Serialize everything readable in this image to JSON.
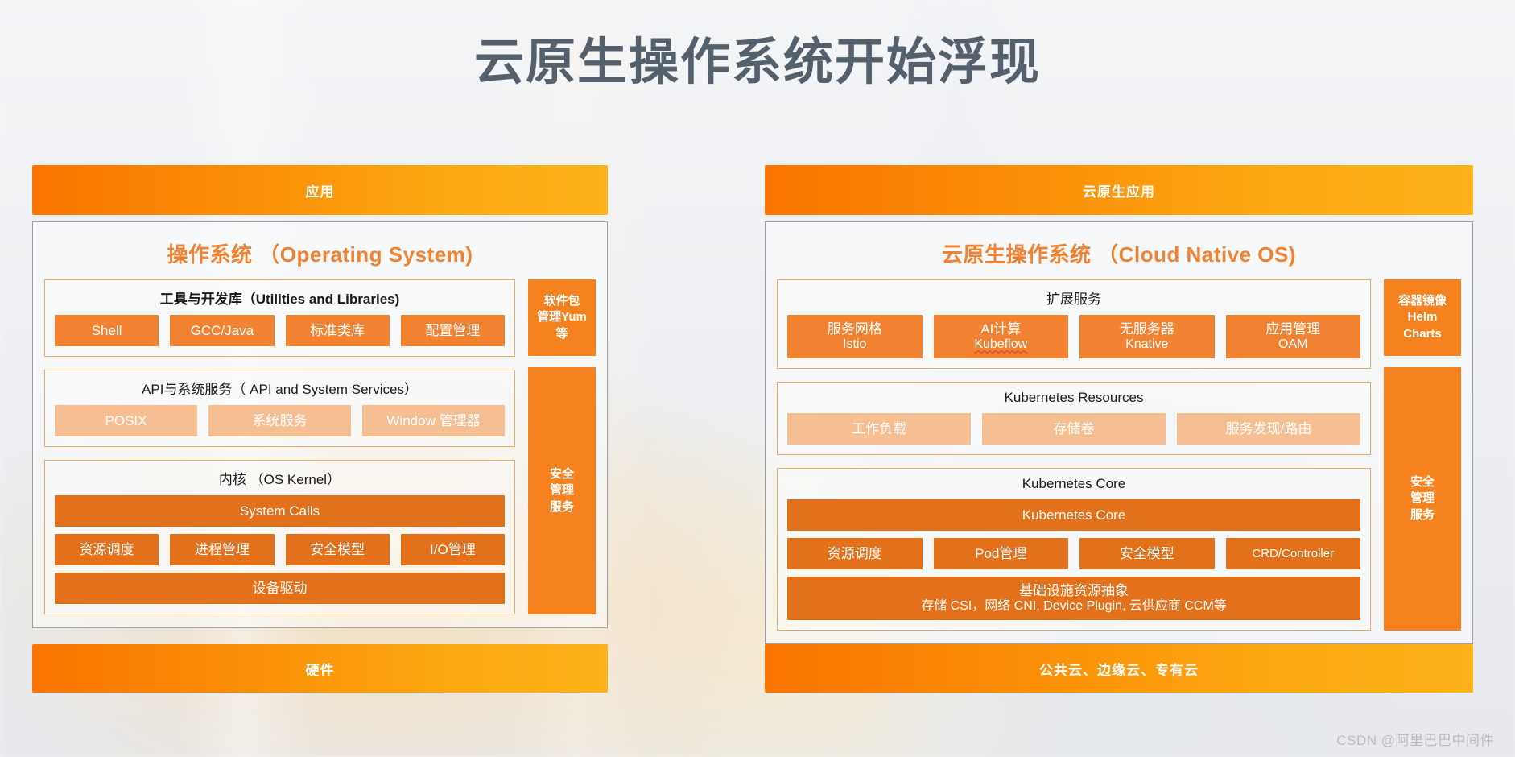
{
  "slide": {
    "title": "云原生操作系统开始浮现",
    "watermark": "CSDN @阿里巴巴中间件"
  },
  "colors": {
    "accent_orange": "#f5811f",
    "chip_orange": "#f08232",
    "chip_dark_orange": "#e3701b",
    "chip_light_orange": "#f6bf93",
    "title_gray": "#54616c",
    "panel_border": "#9aa0a6",
    "group_border": "#e8a86a"
  },
  "left_panel": {
    "top_bar": "应用",
    "os_title": "操作系统 （Operating System)",
    "groups": [
      {
        "title": "工具与开发库（Utilities and Libraries)",
        "title_bold": true,
        "rows": [
          {
            "style": "solid",
            "items": [
              "Shell",
              "GCC/Java",
              "标准类库",
              "配置管理"
            ]
          }
        ]
      },
      {
        "title": "API与系统服务（ API and  System Services）",
        "title_bold": false,
        "rows": [
          {
            "style": "light",
            "items": [
              "POSIX",
              "系统服务",
              "Window 管理器"
            ]
          }
        ]
      },
      {
        "title": "内核 （OS Kernel）",
        "title_bold": false,
        "rows": [
          {
            "style": "dark",
            "items": [
              "System Calls"
            ]
          },
          {
            "style": "dark",
            "items": [
              "资源调度",
              "进程管理",
              "安全模型",
              "I/O管理"
            ]
          },
          {
            "style": "dark",
            "items": [
              "设备驱动"
            ]
          }
        ]
      }
    ],
    "side": {
      "package": [
        "软件包",
        "管理Yum",
        "等"
      ],
      "security": [
        "安全",
        "管理",
        "服务"
      ]
    },
    "bottom_bar": "硬件"
  },
  "right_panel": {
    "top_bar": "云原生应用",
    "os_title": "云原生操作系统 （Cloud Native OS)",
    "groups": [
      {
        "title": "扩展服务",
        "title_bold": false,
        "rows": [
          {
            "style": "solid",
            "two_line": true,
            "items": [
              {
                "line1": "服务网格",
                "line2": "Istio",
                "squiggle": false
              },
              {
                "line1": "AI计算",
                "line2": "Kubeflow",
                "squiggle": true
              },
              {
                "line1": "无服务器",
                "line2": "Knative",
                "squiggle": false
              },
              {
                "line1": "应用管理",
                "line2": "OAM",
                "squiggle": false
              }
            ]
          }
        ]
      },
      {
        "title": "Kubernetes Resources",
        "title_bold": false,
        "rows": [
          {
            "style": "light",
            "items": [
              "工作负载",
              "存储卷",
              "服务发现/路由"
            ]
          }
        ]
      },
      {
        "title": "Kubernetes Core",
        "title_bold": false,
        "rows": [
          {
            "style": "dark",
            "items": [
              "Kubernetes Core"
            ]
          },
          {
            "style": "dark",
            "items": [
              "资源调度",
              "Pod管理",
              "安全模型",
              "CRD/Controller"
            ]
          }
        ],
        "infra": {
          "line1": "基础设施资源抽象",
          "line2": "存储 CSI，网络 CNI, Device Plugin, 云供应商 CCM等"
        }
      }
    ],
    "side": {
      "package": [
        "容器镜像",
        "Helm",
        "Charts"
      ],
      "security": [
        "安全",
        "管理",
        "服务"
      ]
    },
    "bottom_bar": "公共云、边缘云、专有云"
  }
}
